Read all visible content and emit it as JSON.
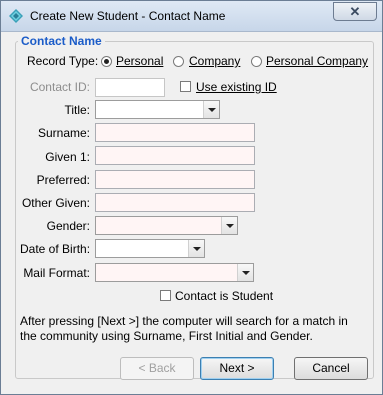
{
  "window": {
    "title": "Create New Student - Contact Name",
    "close_glyph": "✕",
    "icon": "app-diamond-icon"
  },
  "group": {
    "title": "Contact Name"
  },
  "record_type": {
    "label": "Record Type:",
    "options": [
      {
        "label": "Personal",
        "checked": true
      },
      {
        "label": "Company",
        "checked": false
      },
      {
        "label": "Personal Company",
        "checked": false
      }
    ]
  },
  "contact_id": {
    "label": "Contact ID:",
    "value": "",
    "use_existing_label": "Use existing ID",
    "use_existing_checked": false
  },
  "fields": {
    "title": {
      "label": "Title:",
      "value": ""
    },
    "surname": {
      "label": "Surname:",
      "value": ""
    },
    "given1": {
      "label": "Given 1:",
      "value": ""
    },
    "preferred": {
      "label": "Preferred:",
      "value": ""
    },
    "other_given": {
      "label": "Other Given:",
      "value": ""
    },
    "gender": {
      "label": "Gender:",
      "value": ""
    },
    "dob": {
      "label": "Date of Birth:",
      "value": ""
    },
    "mail_format": {
      "label": "Mail Format:",
      "value": ""
    }
  },
  "contact_is_student": {
    "label": "Contact is Student",
    "checked": false
  },
  "note": "After pressing [Next >] the computer will search for a match in the community using Surname, First Initial and Gender.",
  "buttons": {
    "back": "< Back",
    "next": "Next >",
    "cancel": "Cancel"
  },
  "colors": {
    "group_title": "#1b5cc8",
    "required_field_bg": "#fff5f5"
  }
}
